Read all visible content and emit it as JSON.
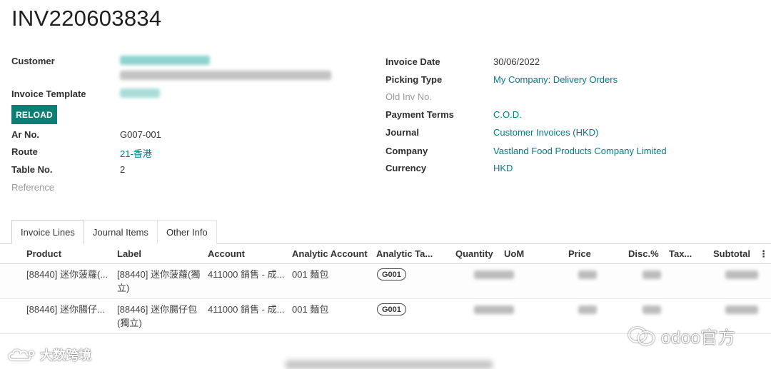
{
  "record": {
    "title": "INV220603834"
  },
  "left_fields": {
    "customer_label": "Customer",
    "invoice_template_label": "Invoice Template",
    "reload_label": "RELOAD",
    "ar_no_label": "Ar No.",
    "ar_no_value": "G007-001",
    "route_label": "Route",
    "route_value": "21-香港",
    "table_no_label": "Table No.",
    "table_no_value": "2",
    "reference_label": "Reference"
  },
  "right_fields": {
    "invoice_date_label": "Invoice Date",
    "invoice_date_value": "30/06/2022",
    "picking_type_label": "Picking Type",
    "picking_type_value": "My Company: Delivery Orders",
    "old_inv_no_label": "Old Inv No.",
    "payment_terms_label": "Payment Terms",
    "payment_terms_value": "C.O.D.",
    "journal_label": "Journal",
    "journal_value": "Customer Invoices (HKD)",
    "company_label": "Company",
    "company_value": "Vastland Food Products Company Limited",
    "currency_label": "Currency",
    "currency_value": "HKD"
  },
  "tabs": [
    {
      "label": "Invoice Lines",
      "active": true
    },
    {
      "label": "Journal Items",
      "active": false
    },
    {
      "label": "Other Info",
      "active": false
    }
  ],
  "table": {
    "headers": {
      "product": "Product",
      "label": "Label",
      "account": "Account",
      "analytic_account": "Analytic Account",
      "analytic_tags": "Analytic Ta...",
      "quantity": "Quantity",
      "uom": "UoM",
      "price": "Price",
      "disc": "Disc.%",
      "tax": "Tax...",
      "subtotal": "Subtotal",
      "more": "⋮"
    },
    "rows": [
      {
        "product": "[88440] 迷你菠蘿(...",
        "label_line1": "[88440] 迷你菠蘿(獨",
        "label_line2": "立)",
        "account": "411000 銷售 - 成...",
        "analytic_account": "001 麵包",
        "tag": "G001"
      },
      {
        "product": "[88446] 迷你腸仔...",
        "label_line1": "[88446] 迷你腸仔包",
        "label_line2": "(獨立)",
        "account": "411000 銷售 - 成...",
        "analytic_account": "001 麵包",
        "tag": "G001"
      }
    ]
  },
  "watermarks": {
    "left": "大数跨境",
    "right": "odoo官方"
  },
  "colors": {
    "accent": "#017e84",
    "button": "#0b7f73"
  }
}
